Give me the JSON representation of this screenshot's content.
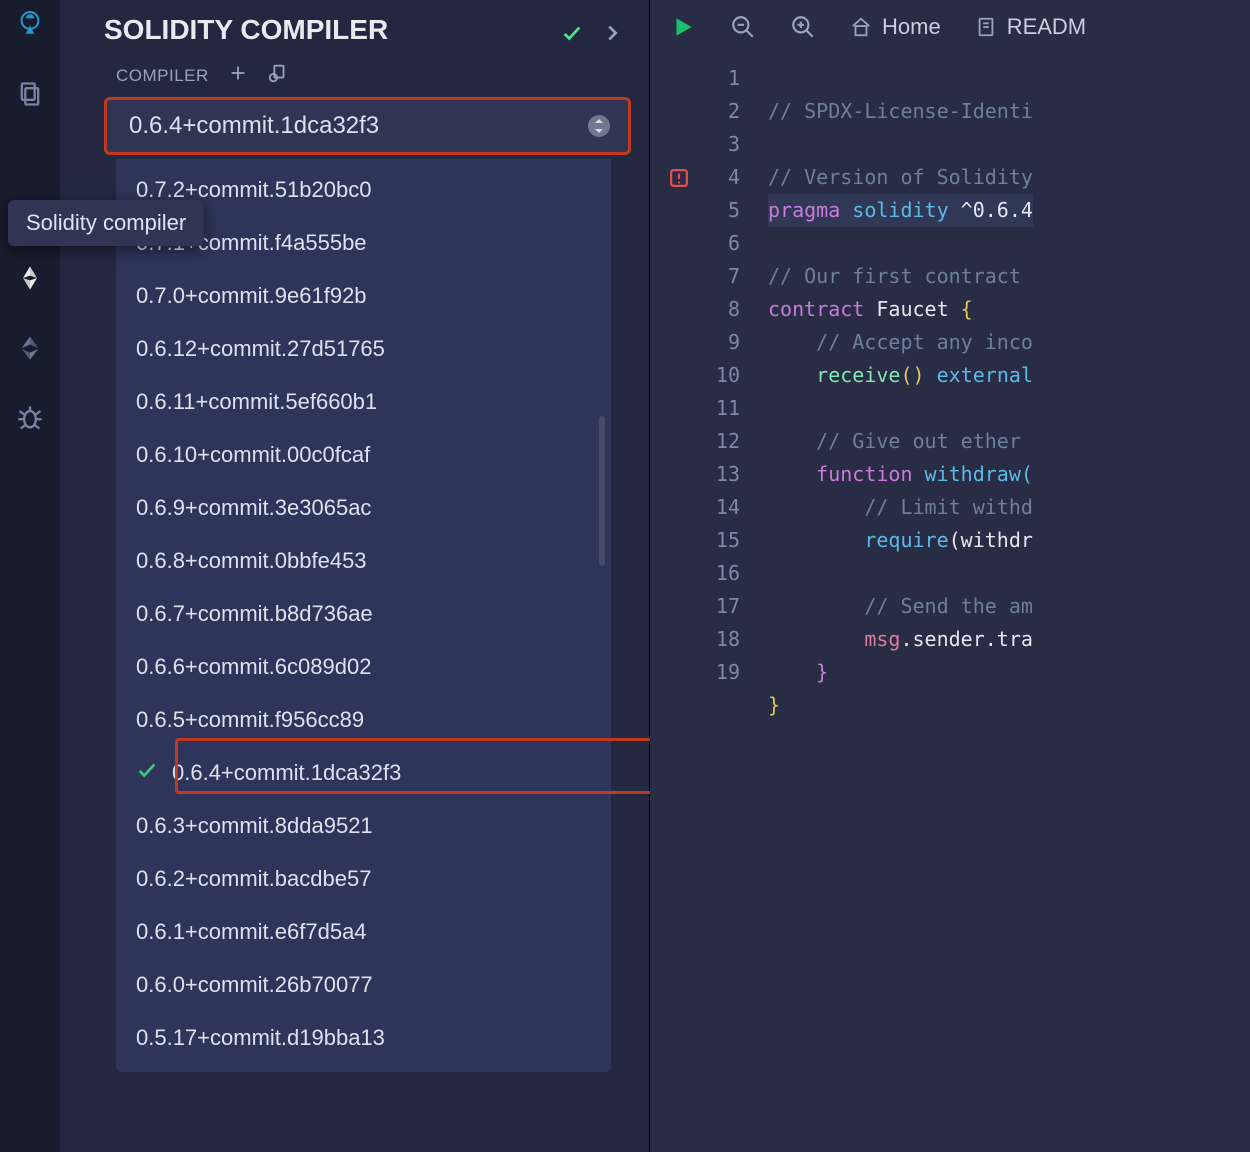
{
  "tooltip": "Solidity compiler",
  "panel": {
    "title": "SOLIDITY COMPILER",
    "tab_label": "COMPILER",
    "selected_version": "0.6.4+commit.1dca32f3",
    "versions": [
      "0.7.2+commit.51b20bc0",
      "0.7.1+commit.f4a555be",
      "0.7.0+commit.9e61f92b",
      "0.6.12+commit.27d51765",
      "0.6.11+commit.5ef660b1",
      "0.6.10+commit.00c0fcaf",
      "0.6.9+commit.3e3065ac",
      "0.6.8+commit.0bbfe453",
      "0.6.7+commit.b8d736ae",
      "0.6.6+commit.6c089d02",
      "0.6.5+commit.f956cc89",
      "0.6.4+commit.1dca32f3",
      "0.6.3+commit.8dda9521",
      "0.6.2+commit.bacdbe57",
      "0.6.1+commit.e6f7d5a4",
      "0.6.0+commit.26b70077",
      "0.5.17+commit.d19bba13"
    ],
    "selected_index": 11
  },
  "toolbar": {
    "home_label": "Home",
    "readme_label": "READM"
  },
  "code": {
    "line_count": 19,
    "l1": "// SPDX-License-Identi",
    "l3": "// Version of Solidity",
    "l4a": "pragma",
    "l4b": "solidity",
    "l4c": "^0.6.4",
    "l6": "// Our first contract ",
    "l7a": "contract",
    "l7b": "Faucet",
    "l7c": "{",
    "l8": "// Accept any inco",
    "l9a": "receive",
    "l9b": "()",
    "l9c": "external",
    "l11": "// Give out ether ",
    "l12a": "function",
    "l12b": "withdraw(",
    "l13": "// Limit withd",
    "l14a": "require",
    "l14b": "(withdr",
    "l16": "// Send the am",
    "l17a": "msg",
    "l17b": ".sender.tra",
    "l18": "}",
    "l19": "}"
  }
}
